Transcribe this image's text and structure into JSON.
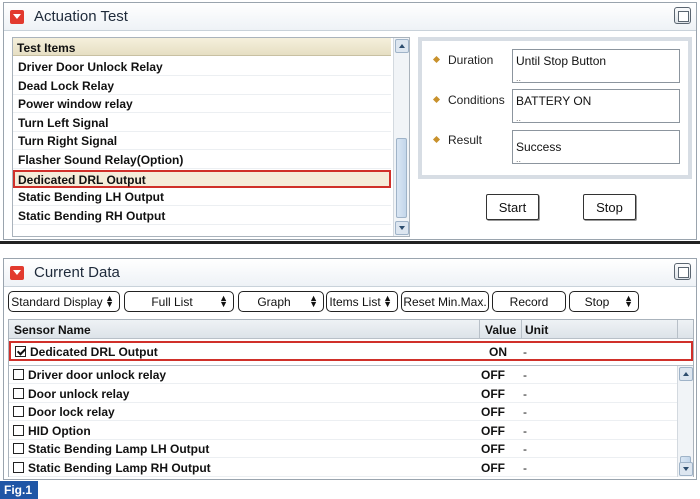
{
  "actuation": {
    "title": "Actuation Test",
    "list_header": "Test Items",
    "items": [
      "Driver Door Unlock Relay",
      "Dead Lock Relay",
      "Power window relay",
      "Turn Left Signal",
      "Turn Right Signal",
      "Flasher Sound Relay(Option)",
      "Dedicated DRL Output",
      "Static Bending LH Output",
      "Static Bending RH Output"
    ],
    "selected_index": 6,
    "info": {
      "duration_label": "Duration",
      "duration_value": "Until Stop Button",
      "conditions_label": "Conditions",
      "conditions_value": "BATTERY ON",
      "result_label": "Result",
      "result_value": "Success"
    },
    "start_label": "Start",
    "stop_label": "Stop"
  },
  "current": {
    "title": "Current Data",
    "toolbar": {
      "standard_display": "Standard Display",
      "full_list": "Full List",
      "graph": "Graph",
      "items_list": "Items List",
      "reset_minmax": "Reset Min.Max.",
      "record": "Record",
      "stop": "Stop"
    },
    "headers": {
      "name": "Sensor Name",
      "value": "Value",
      "unit": "Unit"
    },
    "pinned_row": {
      "name": "Dedicated DRL Output",
      "value": "ON",
      "unit": "-",
      "checked": true
    },
    "rows": [
      {
        "name": "Driver door unlock relay",
        "value": "OFF",
        "unit": "-"
      },
      {
        "name": "Door unlock relay",
        "value": "OFF",
        "unit": "-"
      },
      {
        "name": "Door lock relay",
        "value": "OFF",
        "unit": "-"
      },
      {
        "name": "HID Option",
        "value": "OFF",
        "unit": "-"
      },
      {
        "name": "Static Bending Lamp LH Output",
        "value": "OFF",
        "unit": "-"
      },
      {
        "name": "Static Bending Lamp RH Output",
        "value": "OFF",
        "unit": "-"
      }
    ]
  },
  "figure_label": "Fig.1",
  "colors": {
    "accent_red": "#e23a2e",
    "highlight_border": "#d0302a",
    "figure_blue": "#1f56a6"
  }
}
